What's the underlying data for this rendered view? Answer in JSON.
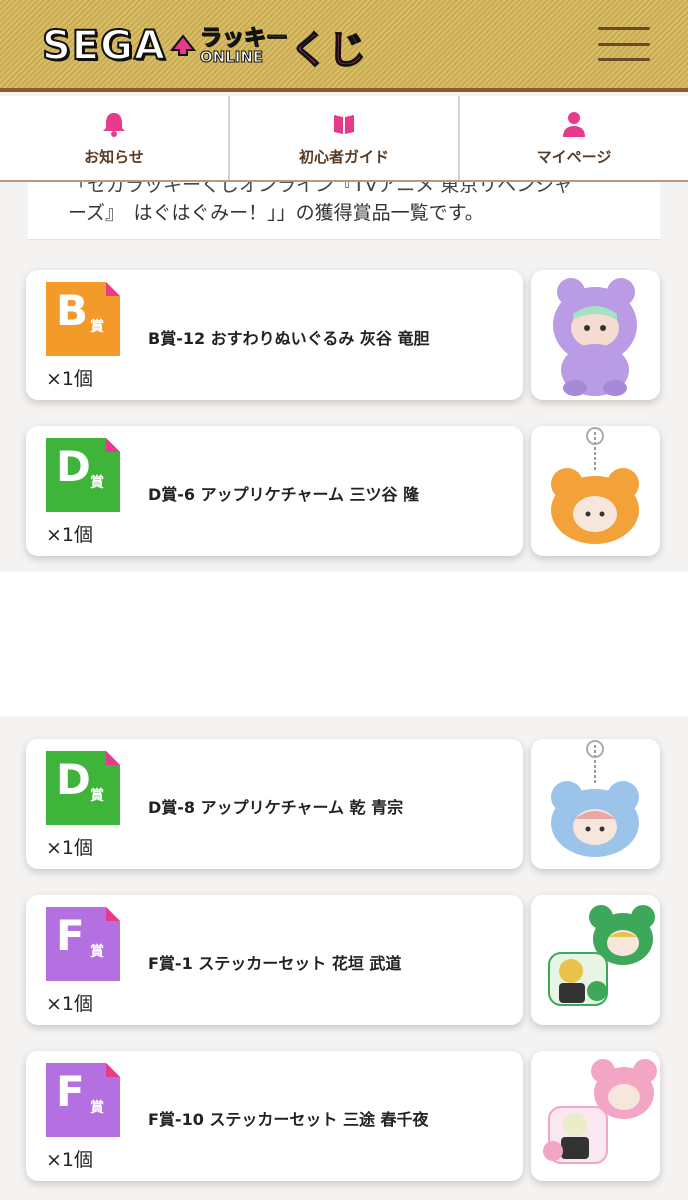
{
  "header": {
    "logo_sega": "SEGA",
    "logo_lucky": "ラッキー",
    "logo_online": "ONLINE",
    "logo_kuji": "くじ"
  },
  "nav": {
    "items": [
      {
        "label": "お知らせ",
        "icon": "bell-icon"
      },
      {
        "label": "初心者ガイド",
        "icon": "book-icon"
      },
      {
        "label": "マイページ",
        "icon": "user-icon"
      }
    ]
  },
  "intro": {
    "line1": "「セガラッキーくじオンライン『TVアニメ 東京リベンジャ",
    "line2": "ーズ』　はぐはぐみー！」」の獲得賞品一覧です。"
  },
  "prizes": [
    {
      "grade": "B",
      "sho": "賞",
      "name": "B賞-12 おすわりぬいぐるみ 灰谷 竜胆",
      "qty": "×1個",
      "color": "#f39a2a",
      "thumb": "purple-plush-image"
    },
    {
      "grade": "D",
      "sho": "賞",
      "name": "D賞-6 アップリケチャーム 三ツ谷 隆",
      "qty": "×1個",
      "color": "#3fb43a",
      "thumb": "orange-charm-image"
    },
    {
      "grade": "D",
      "sho": "賞",
      "name": "D賞-8 アップリケチャーム 乾 青宗",
      "qty": "×1個",
      "color": "#3fb43a",
      "thumb": "blue-charm-image"
    },
    {
      "grade": "F",
      "sho": "賞",
      "name": "F賞-1 ステッカーセット 花垣 武道",
      "qty": "×1個",
      "color": "#b46fe0",
      "thumb": "green-sticker-image"
    },
    {
      "grade": "F",
      "sho": "賞",
      "name": "F賞-10 ステッカーセット 三途 春千夜",
      "qty": "×1個",
      "color": "#b46fe0",
      "thumb": "pink-sticker-image"
    }
  ],
  "colors": {
    "accent_pink": "#e73a8a",
    "nav_text": "#5a3a22",
    "header_gold": "#d8be6a"
  }
}
